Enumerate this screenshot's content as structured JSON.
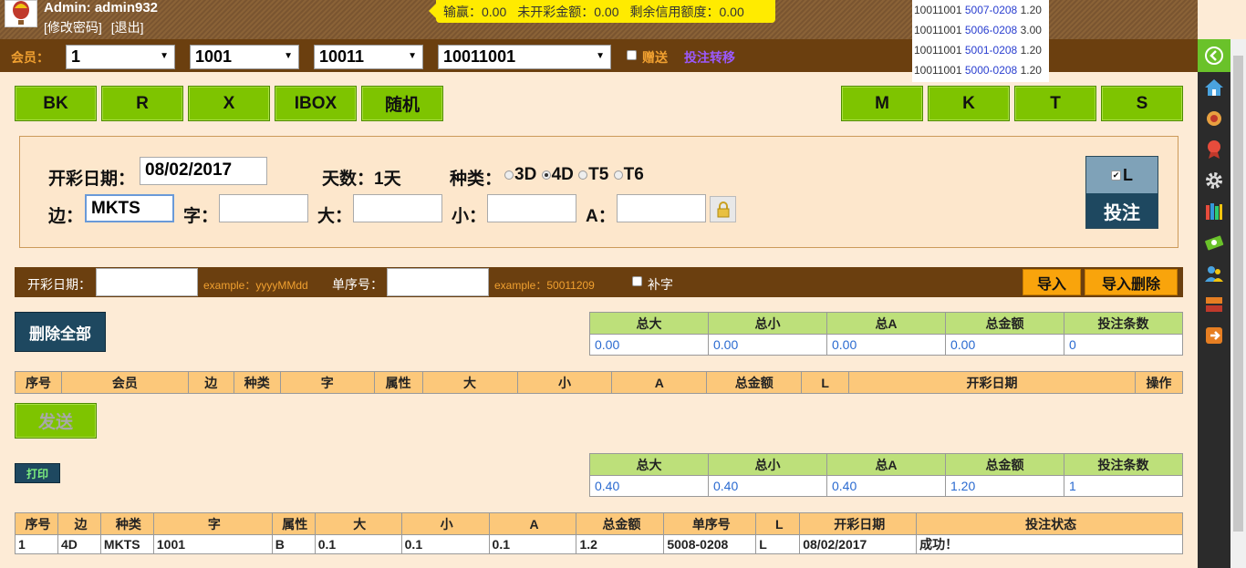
{
  "header": {
    "admin": "Admin: admin932",
    "change_pwd": "[修改密码]",
    "logout": "[退出]",
    "balance": {
      "win_loss": "输赢：0.00",
      "unsettled": "未开彩金额：0.00",
      "credit": "剩余信用额度：0.00"
    }
  },
  "ticker": [
    {
      "a": "10011001",
      "b": "5007-0208",
      "c": "1.20"
    },
    {
      "a": "10011001",
      "b": "5006-0208",
      "c": "3.00"
    },
    {
      "a": "10011001",
      "b": "5001-0208",
      "c": "1.20"
    },
    {
      "a": "10011001",
      "b": "5000-0208",
      "c": "1.20"
    }
  ],
  "toolbar": {
    "member_label": "会员：",
    "sel1": "1",
    "sel2": "1001",
    "sel3": "10011",
    "sel4": "10011001",
    "gift": "赠送",
    "transfer": "投注转移"
  },
  "buttons": {
    "bk": "BK",
    "r": "R",
    "x": "X",
    "ibox": "IBOX",
    "random": "随机",
    "m": "M",
    "k": "K",
    "t": "T",
    "s": "S"
  },
  "form": {
    "date_label": "开彩日期：",
    "date_value": "08/02/2017",
    "days": "天数：1天",
    "type_label": "种类：",
    "types": [
      "3D",
      "4D",
      "T5",
      "T6"
    ],
    "bian_label": "边：",
    "bian_value": "MKTS",
    "zi_label": "字：",
    "da_label": "大：",
    "xiao_label": "小：",
    "a_label": "A：",
    "l_label": "L",
    "bet_button": "投注"
  },
  "import_bar": {
    "date_label": "开彩日期：",
    "date_example": "example：yyyyMMdd",
    "order_label": "单序号：",
    "order_example": "example：50011209",
    "buzi": "补字",
    "import": "导入",
    "import_delete": "导入删除"
  },
  "delete_all": "删除全部",
  "summary1": {
    "headers": [
      "总大",
      "总小",
      "总A",
      "总金额",
      "投注条数"
    ],
    "values": [
      "0.00",
      "0.00",
      "0.00",
      "0.00",
      "0"
    ]
  },
  "bet_table_headers": [
    "序号",
    "会员",
    "边",
    "种类",
    "字",
    "属性",
    "大",
    "小",
    "A",
    "总金额",
    "L",
    "开彩日期",
    "操作"
  ],
  "send": "发送",
  "print": "打印",
  "summary2": {
    "headers": [
      "总大",
      "总小",
      "总A",
      "总金额",
      "投注条数"
    ],
    "values": [
      "0.40",
      "0.40",
      "0.40",
      "1.20",
      "1"
    ]
  },
  "result_table": {
    "headers": [
      "序号",
      "边",
      "种类",
      "字",
      "属性",
      "大",
      "小",
      "A",
      "总金额",
      "单序号",
      "L",
      "开彩日期",
      "投注状态"
    ],
    "rows": [
      [
        "1",
        "4D",
        "MKTS",
        "1001",
        "B",
        "0.1",
        "0.1",
        "0.1",
        "1.2",
        "5008-0208",
        "L",
        "08/02/2017",
        "成功！"
      ]
    ]
  }
}
